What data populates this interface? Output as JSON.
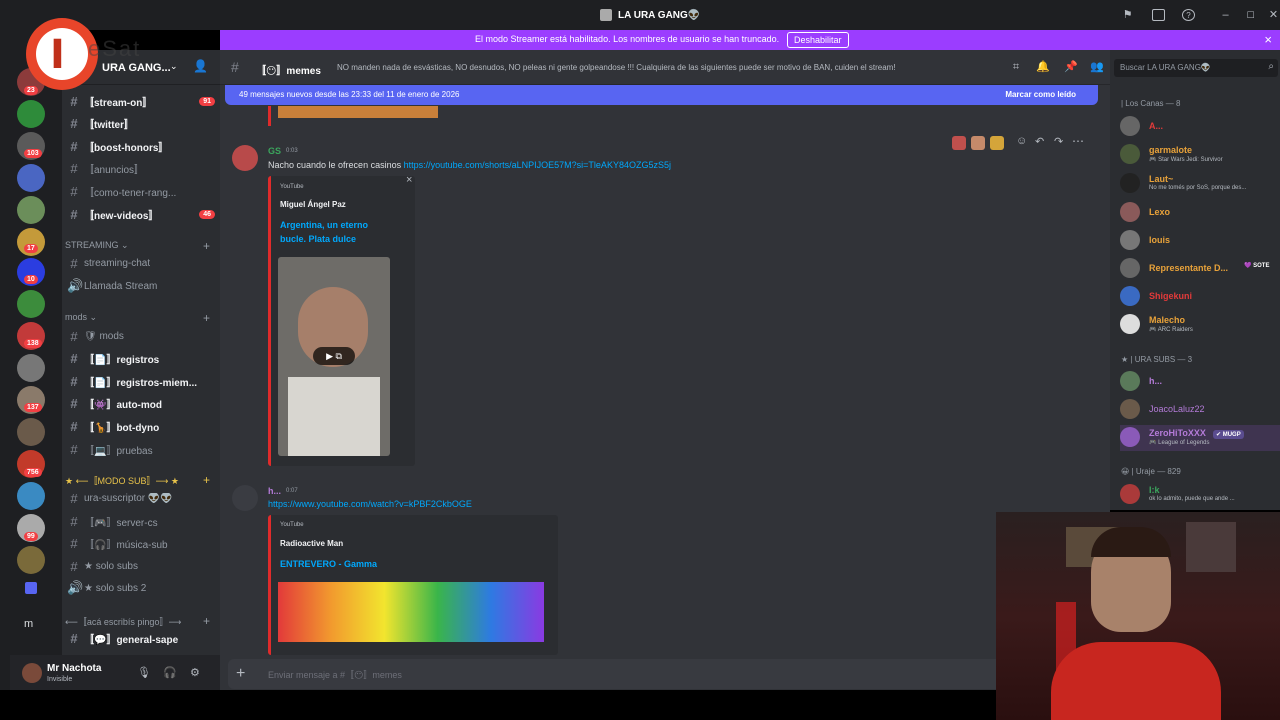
{
  "window": {
    "title": "LA URA GANG👽"
  },
  "banner": {
    "text": "El modo Streamer está habilitado. Los nombres de usuario se han truncado.",
    "button": "Deshabilitar",
    "close": "×"
  },
  "server": {
    "name": "URA GANG...",
    "logo_letter": "I",
    "logo_text": "eSat"
  },
  "guild_badges": [
    "23",
    "103",
    "17",
    "10",
    "138",
    "137",
    "756",
    "99"
  ],
  "rail_letter": "m",
  "channels": [
    {
      "label": "〚stream-on〛",
      "badge": "91",
      "bold": true
    },
    {
      "label": "〚twitter〛",
      "bold": true
    },
    {
      "label": "〚boost-honors〛",
      "bold": true
    },
    {
      "label": "〚anuncios〛",
      "bold": false
    },
    {
      "label": "〚como-tener-rang...",
      "bold": false
    },
    {
      "label": "〚new-videos〛",
      "badge": "46",
      "bold": true
    }
  ],
  "categories": {
    "streaming": "STREAMING",
    "mods": "mods",
    "modo_sub": "★ ⟵〚MODO SUB〛⟶ ★",
    "aca": "⟵〚acá escribís pingo〛⟶"
  },
  "streaming_channels": [
    "streaming-chat",
    "Llamada Stream"
  ],
  "mods_channels": [
    {
      "label": "🛡 mods",
      "bold": false
    },
    {
      "label": "〚📄〛registros",
      "bold": true
    },
    {
      "label": "〚📄〛registros-miem...",
      "bold": true
    },
    {
      "label": "〚👾〛auto-mod",
      "bold": true
    },
    {
      "label": "〚🦒〛bot-dyno",
      "bold": true
    },
    {
      "label": "〚💻〛pruebas",
      "bold": false
    }
  ],
  "sub_channels": [
    {
      "label": "ura-suscriptor 👽👽"
    },
    {
      "label": "〚🎮〛server-cs"
    },
    {
      "label": "〚🎧〛música-sub"
    },
    {
      "label": "★ solo subs"
    },
    {
      "label": "★ solo subs 2"
    }
  ],
  "general_channel": "〚💬〛general-sape",
  "user": {
    "name": "Mr Nachota",
    "status": "Invisible"
  },
  "chat": {
    "channel_name": "〚😶〛memes",
    "topic": "NO manden nada de esvásticas, NO desnudos, NO peleas ni gente golpeandose !!! Cualquiera de las siguientes puede ser motivo de BAN, cuiden el stream!",
    "new_messages": "49 mensajes nuevos desde las 23:33 del 11 de enero de 2026",
    "mark_read": "Marcar como leído",
    "input_placeholder": "Enviar mensaje a #〚😶〛memes"
  },
  "messages": [
    {
      "author": "GS",
      "time": "0:03",
      "text": "Nacho cuando le ofrecen casinos ",
      "link": "https://youtube.com/shorts/aLNPIJOE57M?si=TleAKY84OZG5zS5j",
      "embed": {
        "provider": "YouTube",
        "author": "Miguel Ángel Paz",
        "title": "Argentina, un eterno bucle. Plata dulce"
      }
    },
    {
      "author": "h...",
      "time": "0:07",
      "link": "https://www.youtube.com/watch?v=kPBF2CkbOGE",
      "embed": {
        "provider": "YouTube",
        "author": "Radioactive Man",
        "title": "ENTREVERO - Gamma"
      }
    }
  ],
  "search": {
    "placeholder": "Buscar LA URA GANG👽"
  },
  "member_groups": [
    {
      "label": "| Los Canas — 8"
    },
    {
      "label": "★ | URA SUBS — 3"
    },
    {
      "label": "😀 | Uraje — 829"
    }
  ],
  "members": [
    {
      "name": "A...",
      "color": "#e23a3a"
    },
    {
      "name": "garmalote",
      "color": "#e8a23a",
      "status": "🎮 Star Wars Jedi: Survivor"
    },
    {
      "name": "Laut~",
      "color": "#e8a23a",
      "status": "No me tomés por SoS, porque des..."
    },
    {
      "name": "Lexo",
      "color": "#e8a23a"
    },
    {
      "name": "louis",
      "color": "#e8a23a"
    },
    {
      "name": "Representante D...",
      "color": "#e8a23a",
      "tag": "💜 SOTE"
    },
    {
      "name": "Shigekuni",
      "color": "#e23a3a"
    },
    {
      "name": "Malecho",
      "color": "#e8a23a",
      "status": "🎮 ARC Raiders"
    },
    {
      "name": "h...",
      "color": "#b47bd8"
    },
    {
      "name": "JoacoLaluz22",
      "color": "#b47bd8"
    },
    {
      "name": "ZeroHiToXXX",
      "color": "#b47bd8",
      "status": "🎮 League of Legends",
      "tag": "✔ MUGP"
    },
    {
      "name": "I:k",
      "color": "#3ba55d",
      "status": "ok lo admito, puede que ande ..."
    }
  ]
}
